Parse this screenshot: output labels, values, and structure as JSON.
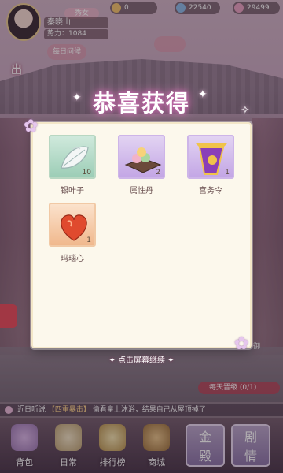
{
  "topbar": {
    "rank": "秀女",
    "player_name": "秦晓山",
    "power_label": "势力：1084",
    "resource_1": "0",
    "resource_2": "22540",
    "resource_3": "29499",
    "mini_button_1": "每日问候",
    "mini_button_2": "",
    "side_tag": "出"
  },
  "reward_popup": {
    "title": "恭喜获得",
    "items": [
      {
        "name": "银叶子",
        "count": "10",
        "quality": "green",
        "icon": "silver-leaf-icon"
      },
      {
        "name": "属性丹",
        "count": "2",
        "quality": "purple",
        "icon": "attribute-pill-icon"
      },
      {
        "name": "宫务令",
        "count": "1",
        "quality": "purple",
        "icon": "palace-token-icon"
      },
      {
        "name": "玛瑙心",
        "count": "1",
        "quality": "orange",
        "icon": "agate-heart-icon"
      }
    ],
    "continue_hint": "点击屏幕继续"
  },
  "side": {
    "right_tag": "御",
    "progress_chip": "每天晋级 (0/1)"
  },
  "notice": {
    "prefix": "近日听说",
    "highlight": "【四重暴击】",
    "text": "偷看皇上沐浴，结果自己从屋顶掉了"
  },
  "bottom_nav": [
    {
      "label": "背包",
      "icon": "bag-icon"
    },
    {
      "label": "日常",
      "icon": "scroll-icon"
    },
    {
      "label": "排行榜",
      "icon": "ranking-icon"
    },
    {
      "label": "商城",
      "icon": "palace-shop-icon"
    }
  ],
  "big_buttons": [
    {
      "label": "金\n殿",
      "icon": "palace-gate-icon"
    },
    {
      "label": "剧\n情",
      "icon": "story-icon"
    }
  ],
  "colors": {
    "title_glow": "#c06aa8",
    "panel_bg": "#fcf8ec",
    "quality_green": "#9ccdb6",
    "quality_purple": "#c3a6e5",
    "quality_orange": "#f0b88d"
  }
}
